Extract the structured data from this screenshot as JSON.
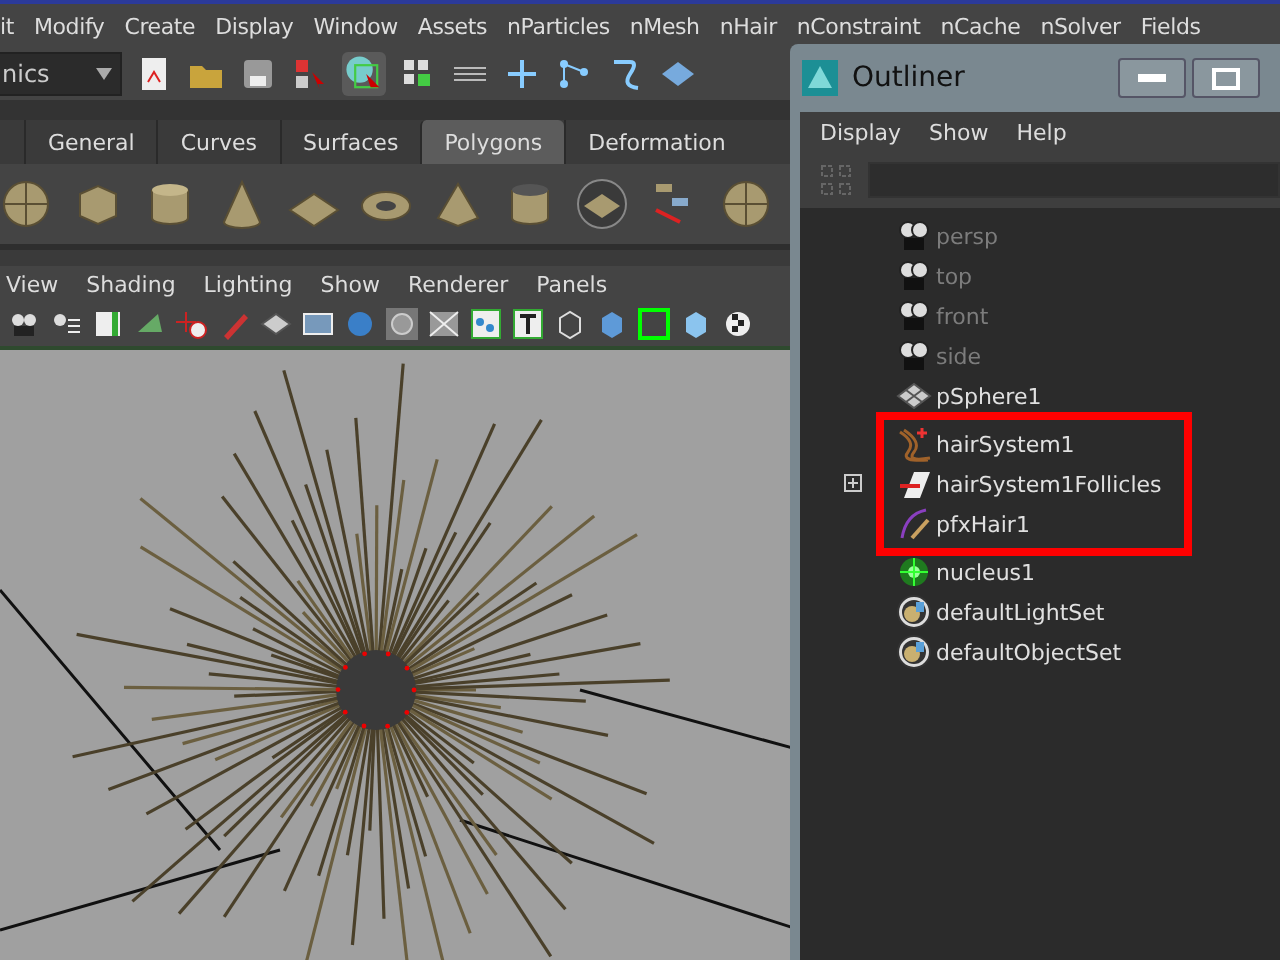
{
  "menu_bar": {
    "items": [
      "it",
      "Modify",
      "Create",
      "Display",
      "Window",
      "Assets",
      "nParticles",
      "nMesh",
      "nHair",
      "nConstraint",
      "nCache",
      "nSolver",
      "Fields"
    ]
  },
  "status_line": {
    "menu_set": "nics"
  },
  "shelf": {
    "tabs": [
      {
        "label": "General",
        "selected": false
      },
      {
        "label": "Curves",
        "selected": false
      },
      {
        "label": "Surfaces",
        "selected": false
      },
      {
        "label": "Polygons",
        "selected": true
      },
      {
        "label": "Deformation",
        "selected": false
      }
    ]
  },
  "panel": {
    "menu": [
      "View",
      "Shading",
      "Lighting",
      "Show",
      "Renderer",
      "Panels"
    ]
  },
  "outliner": {
    "title": "Outliner",
    "menu": [
      "Display",
      "Show",
      "Help"
    ],
    "items": [
      {
        "name": "persp",
        "kind": "camera",
        "dimmed": true,
        "highlighted": false,
        "expandable": false
      },
      {
        "name": "top",
        "kind": "camera",
        "dimmed": true,
        "highlighted": false,
        "expandable": false
      },
      {
        "name": "front",
        "kind": "camera",
        "dimmed": true,
        "highlighted": false,
        "expandable": false
      },
      {
        "name": "side",
        "kind": "camera",
        "dimmed": true,
        "highlighted": false,
        "expandable": false
      },
      {
        "name": "pSphere1",
        "kind": "mesh",
        "dimmed": false,
        "highlighted": false,
        "expandable": false
      },
      {
        "name": "hairSystem1",
        "kind": "hair",
        "dimmed": false,
        "highlighted": true,
        "expandable": false
      },
      {
        "name": "hairSystem1Follicles",
        "kind": "follicles",
        "dimmed": false,
        "highlighted": true,
        "expandable": true
      },
      {
        "name": "pfxHair1",
        "kind": "pfx",
        "dimmed": false,
        "highlighted": true,
        "expandable": false
      },
      {
        "name": "nucleus1",
        "kind": "nucleus",
        "dimmed": false,
        "highlighted": false,
        "expandable": false
      },
      {
        "name": "defaultLightSet",
        "kind": "set",
        "dimmed": false,
        "highlighted": false,
        "expandable": false
      },
      {
        "name": "defaultObjectSet",
        "kind": "set",
        "dimmed": false,
        "highlighted": false,
        "expandable": false
      }
    ]
  }
}
